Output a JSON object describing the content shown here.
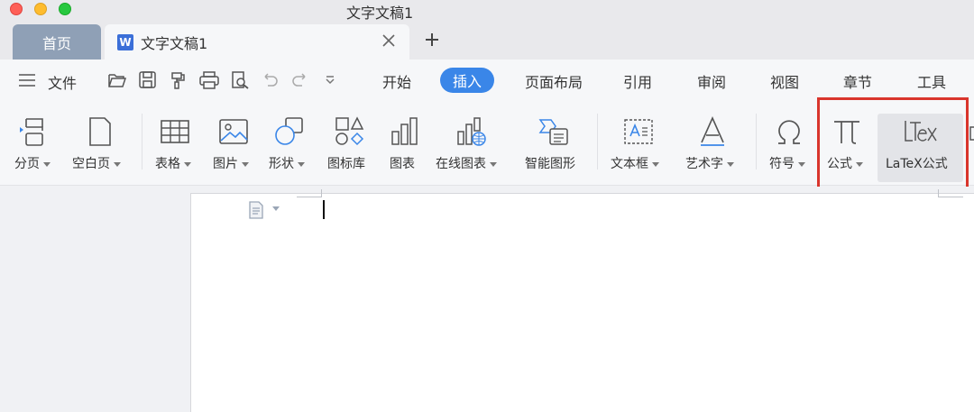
{
  "window": {
    "title": "文字文稿1"
  },
  "tabs": {
    "home_label": "首页",
    "doc_label": "文字文稿1",
    "doc_icon_letter": "W"
  },
  "menu": {
    "file_label": "文件",
    "quick_access_icons": [
      "open-folder-icon",
      "save-icon",
      "format-painter-icon",
      "print-icon",
      "print-preview-icon",
      "undo-icon",
      "redo-icon",
      "customize-toolbar-icon"
    ],
    "tabs": [
      {
        "label": "开始"
      },
      {
        "label": "插入",
        "active": true
      },
      {
        "label": "页面布局"
      },
      {
        "label": "引用"
      },
      {
        "label": "审阅"
      },
      {
        "label": "视图"
      },
      {
        "label": "章节"
      },
      {
        "label": "工具"
      }
    ]
  },
  "ribbon": {
    "tools": [
      {
        "label": "分页",
        "icon": "page-break-icon",
        "dropdown": true
      },
      {
        "label": "空白页",
        "icon": "blank-page-icon",
        "dropdown": true
      },
      {
        "label": "表格",
        "icon": "table-icon",
        "dropdown": true
      },
      {
        "label": "图片",
        "icon": "picture-icon",
        "dropdown": true
      },
      {
        "label": "形状",
        "icon": "shapes-icon",
        "dropdown": true
      },
      {
        "label": "图标库",
        "icon": "icon-library-icon",
        "dropdown": false
      },
      {
        "label": "图表",
        "icon": "chart-icon",
        "dropdown": false
      },
      {
        "label": "在线图表",
        "icon": "online-chart-icon",
        "dropdown": true
      },
      {
        "label": "智能图形",
        "icon": "smart-art-icon",
        "dropdown": false
      },
      {
        "label": "文本框",
        "icon": "text-box-icon",
        "dropdown": true
      },
      {
        "label": "艺术字",
        "icon": "word-art-icon",
        "dropdown": true
      },
      {
        "label": "符号",
        "icon": "omega-symbol-icon",
        "dropdown": true
      },
      {
        "label": "公式",
        "icon": "pi-formula-icon",
        "dropdown": true
      },
      {
        "label": "LaTeX公式",
        "icon": "latex-icon",
        "dropdown": false
      }
    ],
    "highlight_color": "#d9352c"
  },
  "colors": {
    "accent": "#3a86e8",
    "home_tab": "#8fa0b6"
  }
}
